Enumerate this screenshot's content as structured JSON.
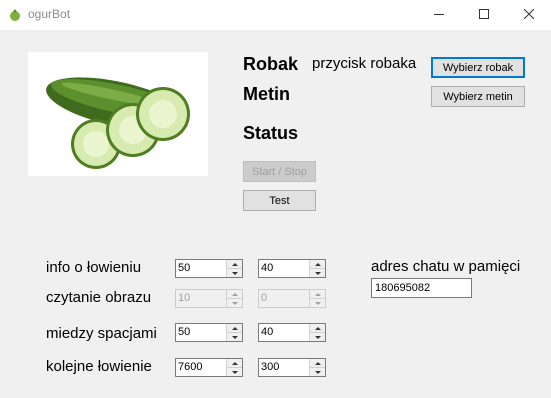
{
  "window": {
    "title": "ogurBot",
    "minimize_icon": "minimize-icon",
    "maximize_icon": "maximize-icon",
    "close_icon": "close-icon"
  },
  "image": {
    "subject": "cucumber-image"
  },
  "labels": {
    "robak": "Robak",
    "robak_value": "przycisk robaka",
    "metin": "Metin",
    "status": "Status",
    "info": "info o łowieniu",
    "czytanie": "czytanie obrazu",
    "miedzy": "miedzy spacjami",
    "kolejne": "kolejne łowienie",
    "adres": "adres chatu w pamięci"
  },
  "buttons": {
    "wybierz_robak": "Wybierz robak",
    "wybierz_metin": "Wybierz metin",
    "start_stop": "Start / Stop",
    "test": "Test"
  },
  "spinners": {
    "info_a": "50",
    "info_b": "40",
    "czytanie_a": "10",
    "czytanie_b": "0",
    "miedzy_a": "50",
    "miedzy_b": "40",
    "kolejne_a": "7600",
    "kolejne_b": "300"
  },
  "adres_value": "180695082",
  "colors": {
    "focus_border": "#0078d7",
    "window_bg": "#f0f0f0"
  }
}
